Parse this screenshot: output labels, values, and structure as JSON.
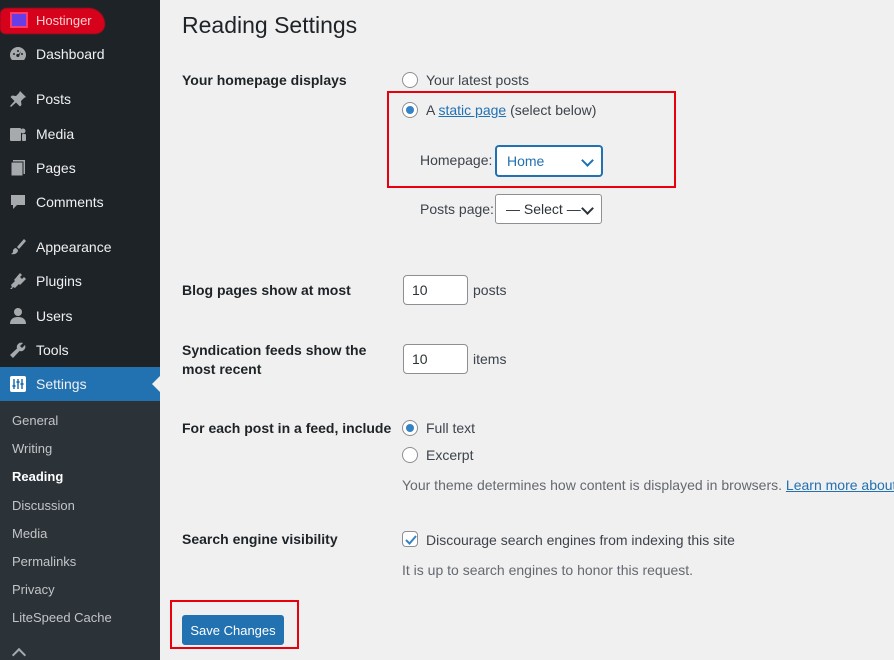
{
  "sidebar": {
    "brand": "Hostinger",
    "menu": [
      {
        "label": "Dashboard",
        "icon": "dashboard-icon"
      },
      {
        "label": "Posts",
        "icon": "pushpin-icon"
      },
      {
        "label": "Media",
        "icon": "media-icon"
      },
      {
        "label": "Pages",
        "icon": "pages-icon"
      },
      {
        "label": "Comments",
        "icon": "comment-icon"
      },
      {
        "label": "Appearance",
        "icon": "paintbrush-icon"
      },
      {
        "label": "Plugins",
        "icon": "plugin-icon"
      },
      {
        "label": "Users",
        "icon": "user-icon"
      },
      {
        "label": "Tools",
        "icon": "wrench-icon"
      },
      {
        "label": "Settings",
        "icon": "settings-sliders-icon"
      }
    ],
    "submenu": [
      "General",
      "Writing",
      "Reading",
      "Discussion",
      "Media",
      "Permalinks",
      "Privacy",
      "LiteSpeed Cache"
    ],
    "current_submenu": "Reading",
    "accent_color": "#2271b1"
  },
  "page": {
    "title": "Reading Settings",
    "homepage_displays": {
      "label": "Your homepage displays",
      "option_latest": "Your latest posts",
      "option_static_prefix": "A",
      "option_static_link": "static page",
      "option_static_suffix": "(select below)",
      "selected": "static page",
      "homepage_label": "Homepage:",
      "homepage_value": "Home",
      "posts_page_label": "Posts page:",
      "posts_page_value": "— Select —"
    },
    "blog_pages": {
      "label": "Blog pages show at most",
      "value": "10",
      "unit": "posts"
    },
    "syndication": {
      "label_line1": "Syndication feeds show the",
      "label_line2": "most recent",
      "value": "10",
      "unit": "items"
    },
    "feed_include": {
      "label": "For each post in a feed, include",
      "option_full": "Full text",
      "option_excerpt": "Excerpt",
      "selected": "Full text",
      "description": "Your theme determines how content is displayed in browsers.",
      "learn_more": "Learn more about"
    },
    "search_visibility": {
      "label": "Search engine visibility",
      "checkbox_label": "Discourage search engines from indexing this site",
      "checked": true,
      "description": "It is up to search engines to honor this request."
    },
    "save_label": "Save Changes",
    "highlight_color": "#e8000d"
  }
}
